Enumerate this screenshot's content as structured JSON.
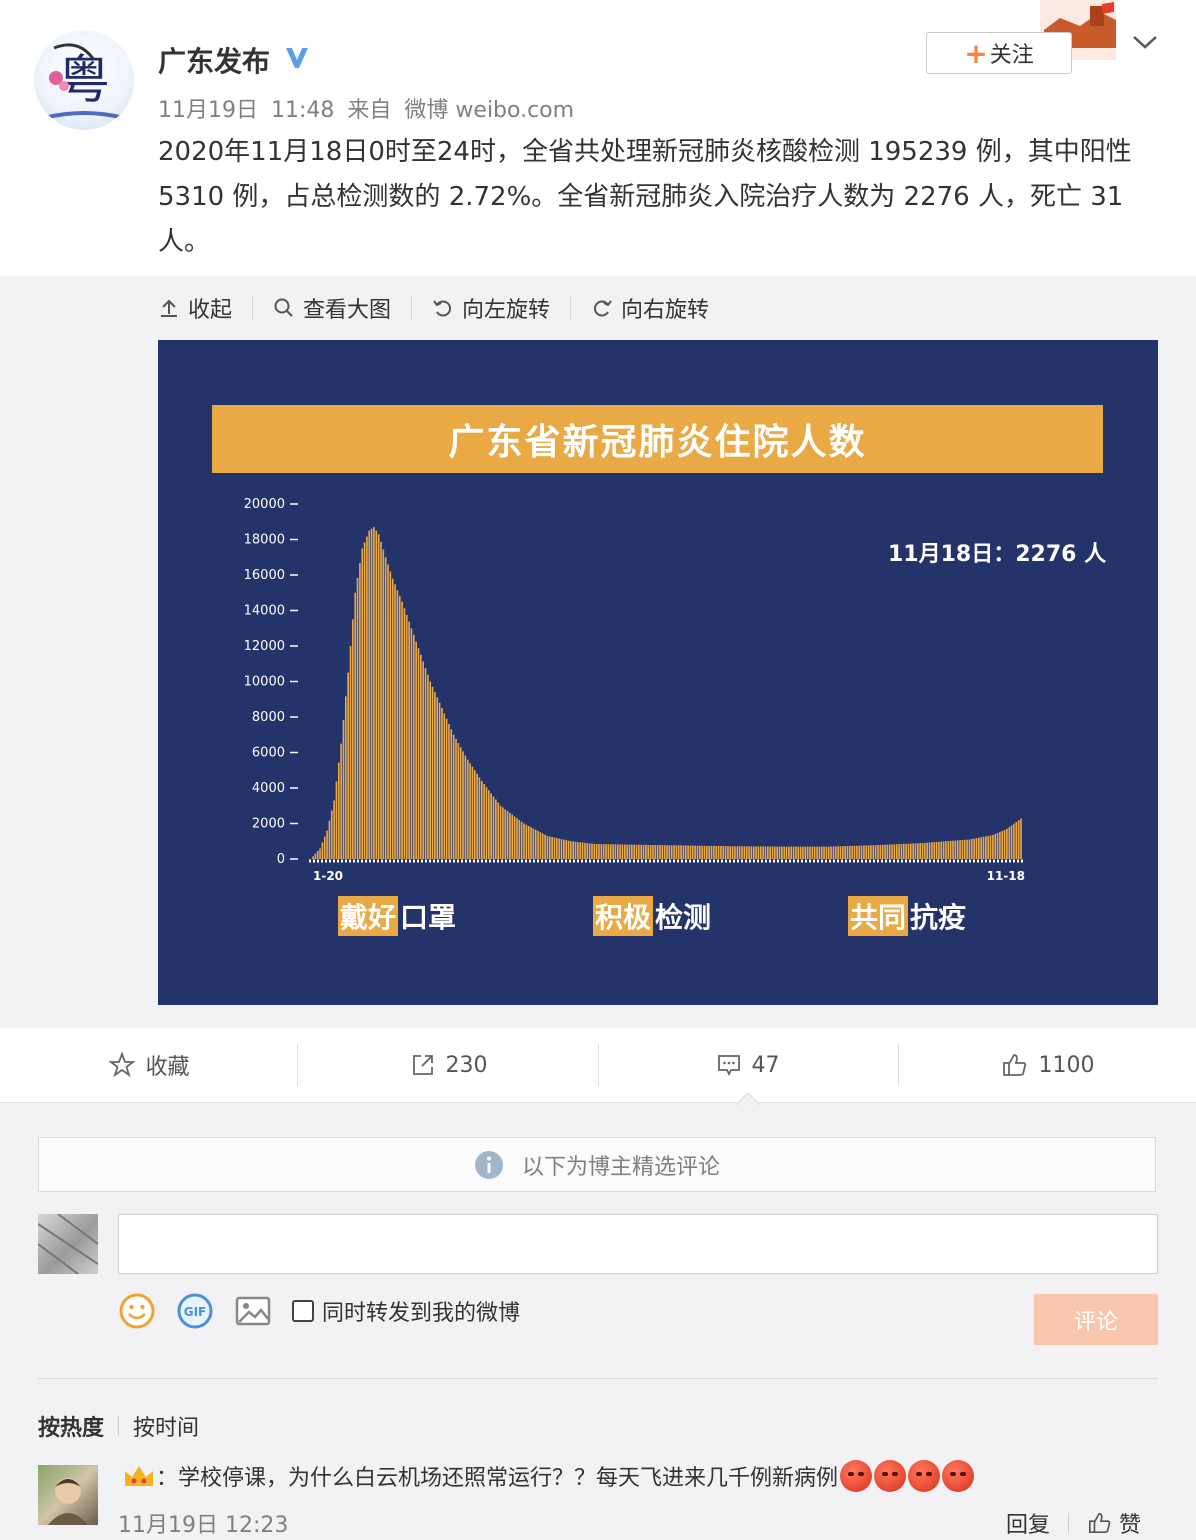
{
  "header": {
    "username": "广东发布",
    "verified": true,
    "meta": {
      "date": "11月19日",
      "time": "11:48",
      "source_prefix": "来自",
      "source": "微博 weibo.com"
    },
    "follow_label": "关注"
  },
  "post": {
    "text": "2020年11月18日0时至24时，全省共处理新冠肺炎核酸检测 195239 例，其中阳性 5310 例，占总检测数的 2.72%。全省新冠肺炎入院治疗人数为 2276 人，死亡 31 人。"
  },
  "media_toolbar": [
    "收起",
    "查看大图",
    "向左旋转",
    "向右旋转"
  ],
  "chart_data": {
    "type": "bar",
    "title": "广东省新冠肺炎住院人数",
    "annotation": "11月18日：2276 人",
    "x_start_label": "1-20",
    "x_end_label": "11-18",
    "y_ticks": [
      "20000",
      "18000",
      "16000",
      "14000",
      "12000",
      "10000",
      "8000",
      "6000",
      "4000",
      "2000",
      "0"
    ],
    "ylim": [
      0,
      20000
    ],
    "anchor_points": [
      [
        0,
        150
      ],
      [
        3,
        600
      ],
      [
        6,
        1600
      ],
      [
        9,
        3300
      ],
      [
        12,
        6500
      ],
      [
        15,
        10500
      ],
      [
        18,
        15000
      ],
      [
        21,
        17500
      ],
      [
        24,
        18500
      ],
      [
        26,
        18700
      ],
      [
        28,
        18300
      ],
      [
        31,
        17000
      ],
      [
        34,
        15800
      ],
      [
        38,
        14500
      ],
      [
        42,
        13000
      ],
      [
        46,
        11500
      ],
      [
        50,
        10000
      ],
      [
        55,
        8500
      ],
      [
        60,
        7000
      ],
      [
        66,
        5600
      ],
      [
        72,
        4400
      ],
      [
        80,
        3000
      ],
      [
        90,
        2000
      ],
      [
        100,
        1300
      ],
      [
        110,
        1000
      ],
      [
        120,
        850
      ],
      [
        140,
        800
      ],
      [
        160,
        760
      ],
      [
        180,
        720
      ],
      [
        200,
        700
      ],
      [
        220,
        700
      ],
      [
        240,
        780
      ],
      [
        260,
        900
      ],
      [
        280,
        1100
      ],
      [
        290,
        1350
      ],
      [
        296,
        1700
      ],
      [
        302,
        2276
      ]
    ],
    "slogans": [
      {
        "highlight": "戴好",
        "rest": "口罩"
      },
      {
        "highlight": "积极",
        "rest": "检测"
      },
      {
        "highlight": "共同",
        "rest": "抗疫"
      }
    ],
    "colors": {
      "bar": "#e9a945",
      "background": "#25336b",
      "axis": "#ffffff"
    }
  },
  "actions": {
    "favorite": "收藏",
    "repost": "230",
    "comment": "47",
    "like": "1100"
  },
  "comments_section": {
    "notice": "以下为博主精选评论",
    "input_placeholder": "",
    "repost_option": "同时转发到我的微博",
    "submit": "评论",
    "sort": {
      "hot": "按热度",
      "time": "按时间"
    },
    "comment": {
      "text": "：学校停课，为什么白云机场还照常运行？？每天飞进来几千例新病例",
      "emoji_count": 4,
      "time": "11月19日 12:23",
      "reply": "回复",
      "like": "赞"
    }
  }
}
